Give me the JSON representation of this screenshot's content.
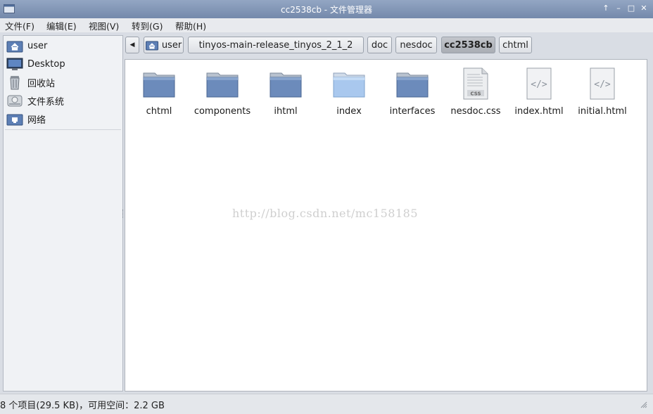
{
  "window": {
    "title": "cc2538cb - 文件管理器",
    "buttons": [
      "↑",
      "–",
      "□",
      "✕"
    ]
  },
  "menu": {
    "items": [
      "文件(F)",
      "编辑(E)",
      "视图(V)",
      "转到(G)",
      "帮助(H)"
    ]
  },
  "sidebar": {
    "items": [
      {
        "label": "user",
        "icon": "home-folder-icon"
      },
      {
        "label": "Desktop",
        "icon": "desktop-icon"
      },
      {
        "label": "回收站",
        "icon": "trash-icon"
      },
      {
        "label": "文件系统",
        "icon": "drive-icon"
      },
      {
        "label": "网络",
        "icon": "network-icon"
      }
    ]
  },
  "pathbar": {
    "back": "◀",
    "crumbs": [
      {
        "label": "user",
        "active": false
      },
      {
        "label": "tinyos-main-release_tinyos_2_1_2",
        "active": false
      },
      {
        "label": "doc",
        "active": false
      },
      {
        "label": "nesdoc",
        "active": false
      },
      {
        "label": "cc2538cb",
        "active": true
      },
      {
        "label": "chtml",
        "active": false
      }
    ]
  },
  "files": [
    {
      "name": "chtml",
      "type": "folder"
    },
    {
      "name": "components",
      "type": "folder"
    },
    {
      "name": "ihtml",
      "type": "folder"
    },
    {
      "name": "index",
      "type": "folder-open"
    },
    {
      "name": "interfaces",
      "type": "folder"
    },
    {
      "name": "nesdoc.css",
      "type": "css",
      "badge": "CSS"
    },
    {
      "name": "index.html",
      "type": "html",
      "badge": "</>"
    },
    {
      "name": "initial.html",
      "type": "html",
      "badge": "</>"
    }
  ],
  "watermark": "http://blog.csdn.net/mc158185",
  "status": {
    "text": "8 个项目(29.5 KB)，可用空间：2.2 GB"
  },
  "colors": {
    "titlebar": "#7f93b5",
    "folder": "#6c8bbb",
    "folder_open": "#a9c8ee",
    "active_crumb": "#b4b8be"
  }
}
